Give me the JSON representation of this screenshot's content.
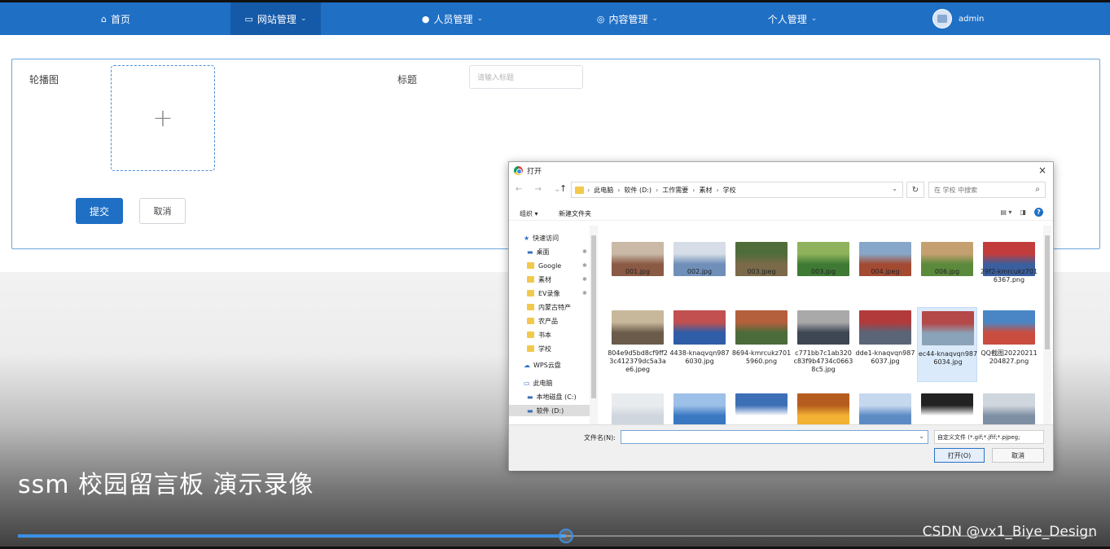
{
  "nav": {
    "items": [
      {
        "label": "首页",
        "icon": "home-icon"
      },
      {
        "label": "网站管理",
        "icon": "monitor-icon"
      },
      {
        "label": "人员管理",
        "icon": "user-icon"
      },
      {
        "label": "内容管理",
        "icon": "chat-icon"
      },
      {
        "label": "个人管理",
        "icon": ""
      }
    ],
    "user": "admin"
  },
  "form": {
    "carousel_label": "轮播图",
    "upload_plus": "+",
    "title_label": "标题",
    "title_placeholder": "请输入标题",
    "submit": "提交",
    "cancel": "取消"
  },
  "video": {
    "title": "ssm 校园留言板 演示录像",
    "progress": 0.51,
    "watermark": "CSDN @vx1_Biye_Design"
  },
  "dialog": {
    "title": "打开",
    "close": "×",
    "breadcrumb": [
      "此电脑",
      "软件 (D:)",
      "工作需要",
      "素材",
      "学校"
    ],
    "search_placeholder": "在 学校 中搜索",
    "organize": "组织 ▾",
    "new_folder": "新建文件夹",
    "sidebar": [
      {
        "label": "快速访问",
        "type": "star"
      },
      {
        "label": "桌面",
        "type": "desktop",
        "pinned": true
      },
      {
        "label": "Google",
        "type": "folder",
        "pinned": true
      },
      {
        "label": "素材",
        "type": "folder",
        "pinned": true
      },
      {
        "label": "EV录像",
        "type": "folder",
        "pinned": true
      },
      {
        "label": "内蒙古特产",
        "type": "folder"
      },
      {
        "label": "农产品",
        "type": "folder"
      },
      {
        "label": "书本",
        "type": "folder"
      },
      {
        "label": "学校",
        "type": "folder"
      },
      {
        "label": "WPS云盘",
        "type": "cloud"
      },
      {
        "label": "此电脑",
        "type": "pc"
      },
      {
        "label": "本地磁盘 (C:)",
        "type": "drive"
      },
      {
        "label": "软件 (D:)",
        "type": "drive",
        "selected": true
      }
    ],
    "files": [
      {
        "name": "001.jpg",
        "colors": [
          "#8b5a44",
          "#c9b9a6"
        ]
      },
      {
        "name": "002.jpg",
        "colors": [
          "#6f8fb8",
          "#d6dde6"
        ]
      },
      {
        "name": "003.jpeg",
        "colors": [
          "#7b6a4a",
          "#4f6d3a"
        ]
      },
      {
        "name": "003.jpg",
        "colors": [
          "#3f7a34",
          "#8fb35c"
        ]
      },
      {
        "name": "004.jpeg",
        "colors": [
          "#a34a32",
          "#87a7c9"
        ]
      },
      {
        "name": "006.jpg",
        "colors": [
          "#5b8a3c",
          "#c4a070"
        ]
      },
      {
        "name": "29f2-kmrcukz7016367.png",
        "colors": [
          "#3a5f9e",
          "#c23c3c"
        ]
      },
      {
        "name": "804e9d5bd8cf9ff23c412379dc5a3ae6.jpeg",
        "colors": [
          "#6b5b4b",
          "#c7b79b"
        ]
      },
      {
        "name": "4438-knaqvqn9876030.jpg",
        "colors": [
          "#2f5da8",
          "#c25050"
        ]
      },
      {
        "name": "8694-kmrcukz7015960.png",
        "colors": [
          "#4b6b3b",
          "#b4603c"
        ]
      },
      {
        "name": "c771bb7c1ab320c83f9b4734c06638c5.jpg",
        "colors": [
          "#3d4652",
          "#a9a9a9"
        ]
      },
      {
        "name": "dde1-knaqvqn9876037.jpg",
        "colors": [
          "#5a6678",
          "#b23a3a"
        ]
      },
      {
        "name": "ec44-knaqvqn9876034.jpg",
        "colors": [
          "#8aa3b8",
          "#b54848"
        ]
      },
      {
        "name": "QQ截图20220211204827.png",
        "colors": [
          "#c94d3f",
          "#4a86c5"
        ]
      },
      {
        "name": "",
        "colors": [
          "#cfd6dd",
          "#e9ecef"
        ]
      },
      {
        "name": "",
        "colors": [
          "#3a78c2",
          "#9cc0e8"
        ]
      },
      {
        "name": "",
        "colors": [
          "#ffffff",
          "#3d6fb6"
        ]
      },
      {
        "name": "",
        "colors": [
          "#f3b233",
          "#b55d1e"
        ]
      },
      {
        "name": "",
        "colors": [
          "#5c8bc4",
          "#c6d8ee"
        ]
      },
      {
        "name": "",
        "colors": [
          "#ffffff",
          "#222222"
        ]
      },
      {
        "name": "",
        "colors": [
          "#7e8fa4",
          "#cfd6dd"
        ]
      }
    ],
    "filename_label": "文件名(N):",
    "filename_value": "",
    "filter": "自定义文件 (*.gif;*.jfif;*.pjpeg;",
    "open": "打开(O)",
    "cancel": "取消"
  }
}
